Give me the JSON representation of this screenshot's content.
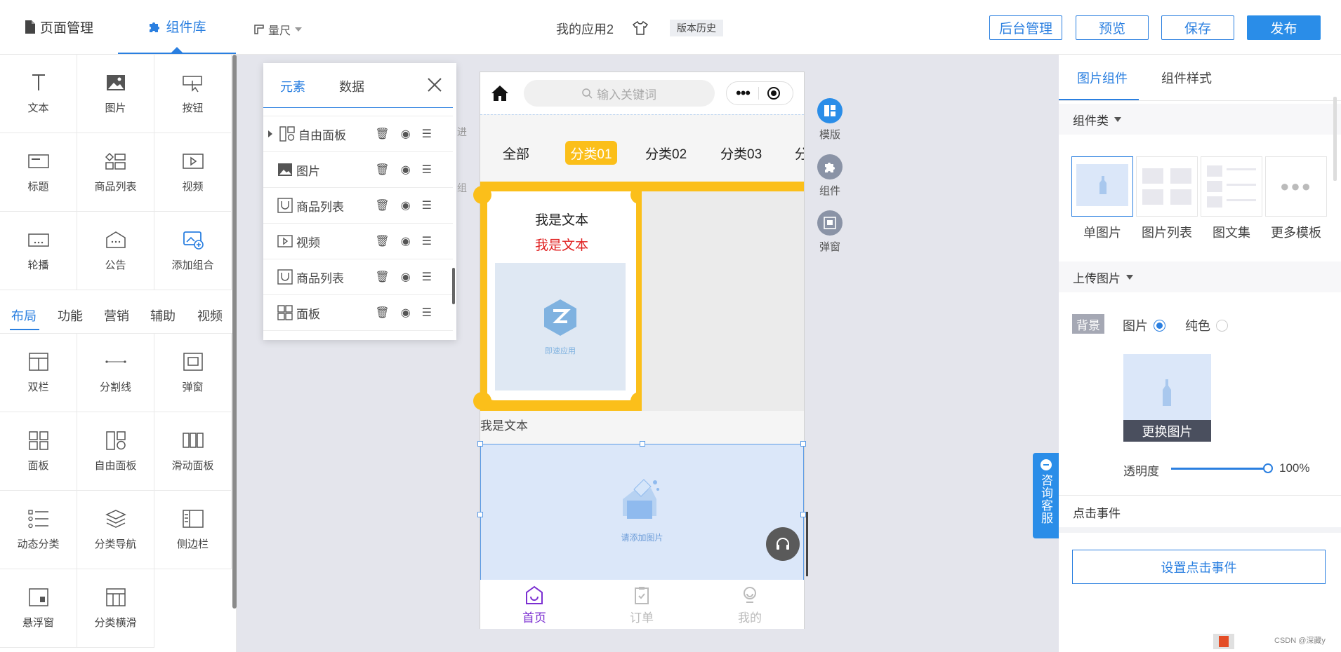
{
  "header": {
    "tab_pages": "页面管理",
    "tab_components": "组件库",
    "ruler": "量尺",
    "app_name": "我的应用2",
    "version_history": "版本历史",
    "btn_admin": "后台管理",
    "btn_preview": "预览",
    "btn_save": "保存",
    "btn_publish": "发布"
  },
  "components": [
    {
      "label": "文本",
      "icon": "text-icon"
    },
    {
      "label": "图片",
      "icon": "image-icon"
    },
    {
      "label": "按钮",
      "icon": "button-icon"
    },
    {
      "label": "标题",
      "icon": "title-icon"
    },
    {
      "label": "商品列表",
      "icon": "product-list-icon"
    },
    {
      "label": "视频",
      "icon": "video-icon"
    },
    {
      "label": "轮播",
      "icon": "carousel-icon"
    },
    {
      "label": "公告",
      "icon": "notice-icon"
    },
    {
      "label": "添加组合",
      "icon": "add-combo-icon"
    }
  ],
  "category_tabs": [
    "布局",
    "功能",
    "营销",
    "辅助",
    "视频"
  ],
  "layout_components": [
    {
      "label": "双栏",
      "icon": "two-column-icon"
    },
    {
      "label": "分割线",
      "icon": "divider-icon"
    },
    {
      "label": "弹窗",
      "icon": "popup-icon"
    },
    {
      "label": "面板",
      "icon": "panel-icon"
    },
    {
      "label": "自由面板",
      "icon": "free-panel-icon"
    },
    {
      "label": "滑动面板",
      "icon": "slide-panel-icon"
    },
    {
      "label": "动态分类",
      "icon": "dynamic-category-icon"
    },
    {
      "label": "分类导航",
      "icon": "category-nav-icon"
    },
    {
      "label": "侧边栏",
      "icon": "sidebar-icon"
    },
    {
      "label": "悬浮窗",
      "icon": "float-window-icon"
    },
    {
      "label": "分类横滑",
      "icon": "category-scroll-icon"
    }
  ],
  "elements_panel": {
    "tab_elements": "元素",
    "tab_data": "数据",
    "partial_row": "面板",
    "rows": [
      {
        "label": "自由面板",
        "expandable": true
      },
      {
        "label": "图片",
        "expandable": false
      },
      {
        "label": "商品列表",
        "expandable": false
      },
      {
        "label": "视频",
        "expandable": false
      },
      {
        "label": "商品列表",
        "expandable": false
      },
      {
        "label": "面板",
        "expandable": false
      }
    ]
  },
  "phone": {
    "search_placeholder": "输入关键词",
    "categories": [
      "全部",
      "分类01",
      "分类02",
      "分类03",
      "分"
    ],
    "card_text_1": "我是文本",
    "card_text_2": "我是文本",
    "card_logo_text": "即速应用",
    "below_text": "我是文本",
    "image_placeholder": "请添加图片",
    "nav": [
      {
        "label": "首页",
        "active": true
      },
      {
        "label": "订单",
        "active": false
      },
      {
        "label": "我的",
        "active": false
      }
    ],
    "peek_labels": [
      "进",
      "组"
    ]
  },
  "side_tools": [
    {
      "label": "模版",
      "icon": "template-icon"
    },
    {
      "label": "组件",
      "icon": "puzzle-icon"
    },
    {
      "label": "弹窗",
      "icon": "popup-icon"
    }
  ],
  "consult_service": "咨询客服",
  "right_panel": {
    "tab_image_comp": "图片组件",
    "tab_comp_style": "组件样式",
    "section_component_type": "组件类",
    "templates": [
      "单图片",
      "图片列表",
      "图文集",
      "更多模板"
    ],
    "section_upload": "上传图片",
    "background_label": "背景",
    "radio_image": "图片",
    "radio_solid": "纯色",
    "change_image": "更换图片",
    "opacity_label": "透明度",
    "opacity_value": "100%",
    "opacity_fraction": 1.0,
    "section_click_event": "点击事件",
    "set_click_event": "设置点击事件"
  },
  "watermark": "CSDN @深藏y",
  "colors": {
    "accent": "#2a7fe0",
    "yellow": "#fbbf1a",
    "active_nav": "#7b2fd1"
  }
}
